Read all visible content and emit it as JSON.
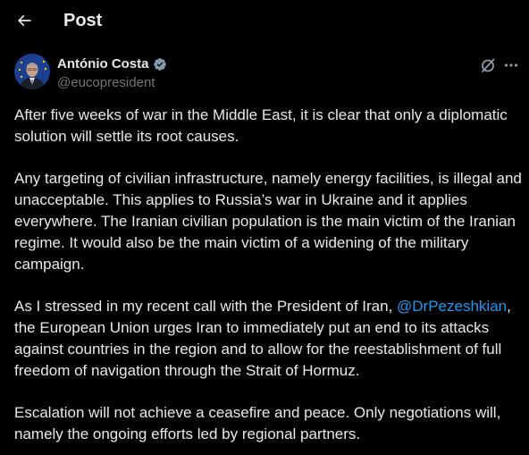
{
  "header": {
    "title": "Post",
    "back_icon": "arrow-left-icon"
  },
  "author": {
    "display_name": "António Costa",
    "handle": "@eucopresident",
    "verified": true,
    "verified_badge": "gray-check-badge-icon"
  },
  "colors": {
    "background": "#000000",
    "text": "#e7e9ea",
    "secondary_text": "#71767b",
    "link": "#1d9bf0"
  },
  "tweet": {
    "p1": "After five weeks of war in the Middle East, it is clear that only a diplomatic solution will settle its root causes.",
    "p2": "Any targeting of civilian infrastructure, namely energy facilities, is illegal and unacceptable. This applies to Russia’s war in Ukraine and it applies everywhere. The Iranian civilian population is the main victim of the Iranian regime. It would also be the main victim of a widening of the military campaign.",
    "p3_before": "As I stressed in my recent call with the President of Iran, ",
    "p3_mention": "@DrPezeshkian",
    "p3_after": ", the European Union urges Iran to immediately put an end to its attacks against countries in the region and to allow for the reestablishment of full freedom of navigation through the Strait of Hormuz.",
    "p4": "Escalation will not achieve a ceasefire and peace. Only negotiations will, namely the ongoing efforts led by regional partners."
  }
}
